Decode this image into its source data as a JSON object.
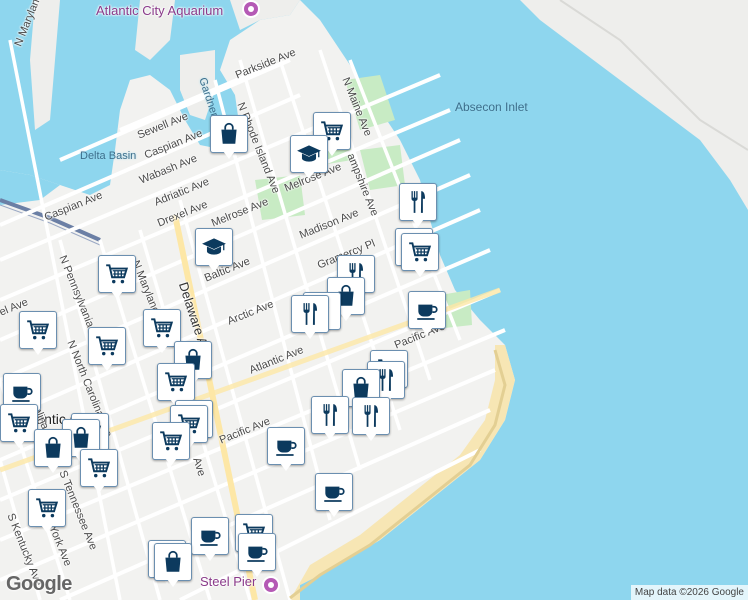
{
  "map": {
    "attribution": "Map data ©2026 Google",
    "logo": "Google",
    "colors": {
      "water": "#8ed6ee",
      "land": "#f2f2f0",
      "park": "#c8ebc4",
      "road": "#ffffff",
      "beach": "#f7e6b4",
      "pinBorder": "#6b8fb0",
      "iconColor": "#0c3a5e"
    }
  },
  "places": {
    "aquarium": "Atlantic City Aquarium",
    "steel_pier": "Steel Pier",
    "absecon_inlet": "Absecon Inlet",
    "delta_basin": "Delta Basin",
    "gardners_basin": "Gardner's",
    "city": "Atlantic Cit"
  },
  "streets": {
    "n_maryland_ave_top": "N Maryland Ave",
    "parkside_ave": "Parkside Ave",
    "n_maine_ave": "N Maine Ave",
    "n_rhode_island_ave": "N Rhode Island Ave",
    "sewell_ave": "Sewell Ave",
    "caspian_ave_top": "Caspian Ave",
    "wabash_ave": "Wabash Ave",
    "adriatic_ave": "Adriatic Ave",
    "drexel_ave": "Drexel Ave",
    "caspian_ave_left": "Caspian Ave",
    "melrose_ave_center": "Melrose Ave",
    "melrose_ave_right": "Melrose Ave",
    "new_hampshire_ave": "ampshire Ave",
    "madison_ave": "Madison Ave",
    "gramercy_pl": "Gramercy Pl",
    "baltic_ave": "Baltic Ave",
    "delaware_ave": "Delaware Ave",
    "n_maryland_ave_mid": "N Maryland Ave",
    "n_pennsylvania_ave": "N Pennsylvania Ave",
    "n_north_carolina_ave": "N North Carolina Ave",
    "carolina_ave": "Carolina Ave",
    "arctic_ave": "Arctic Ave",
    "atlantic_ave": "Atlantic Ave",
    "pacific_ave_center": "Pacific Ave",
    "pacific_ave_right": "Pacific Ave",
    "s_tennessee_ave": "S Tennessee Ave",
    "s_kentucky_ave": "S Kentucky Ave",
    "york_ave": "York Ave",
    "el_ave": "el Ave",
    "ave_short": "Ave"
  }
}
